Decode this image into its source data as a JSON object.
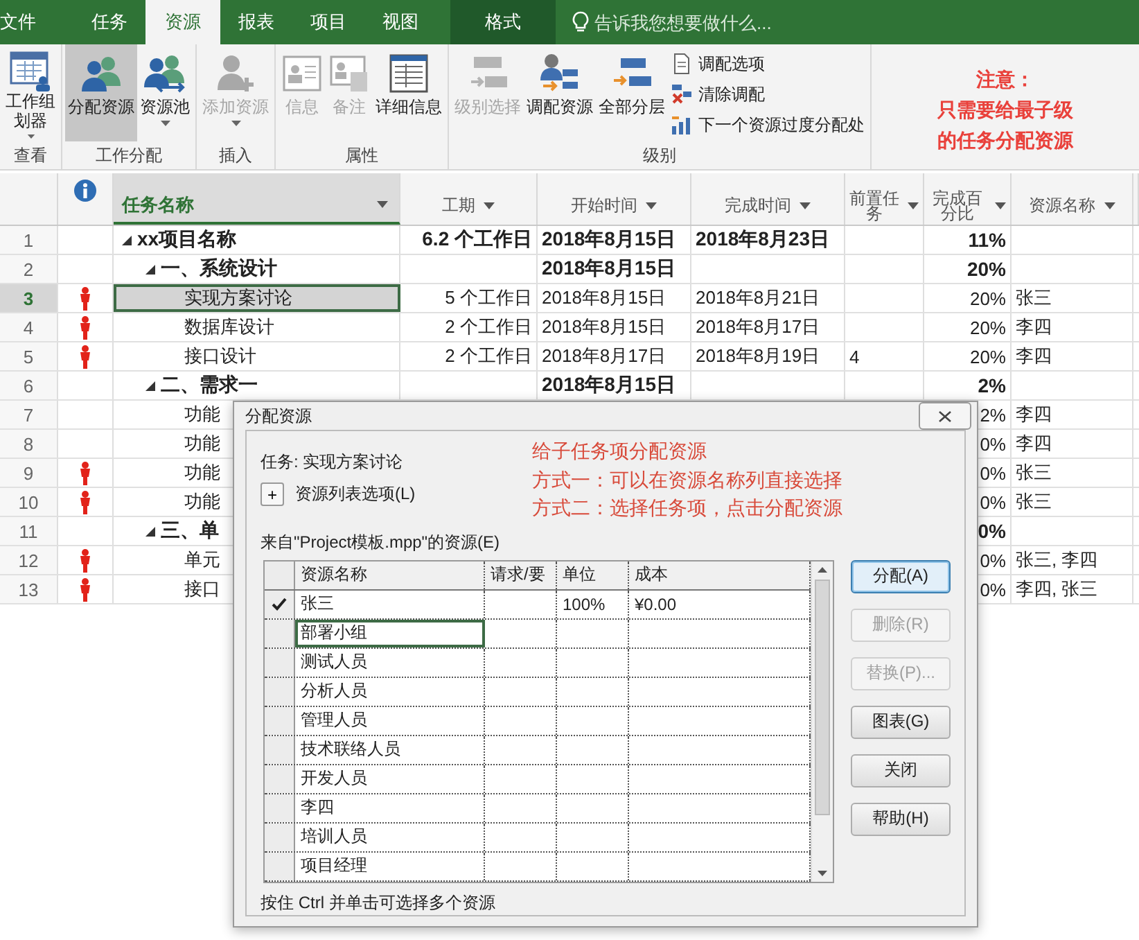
{
  "tabs": [
    {
      "label": "文件",
      "selected": false,
      "contextual": false
    },
    {
      "label": "任务",
      "selected": false,
      "contextual": false
    },
    {
      "label": "资源",
      "selected": true,
      "contextual": false
    },
    {
      "label": "报表",
      "selected": false,
      "contextual": false
    },
    {
      "label": "项目",
      "selected": false,
      "contextual": false
    },
    {
      "label": "视图",
      "selected": false,
      "contextual": false
    },
    {
      "label": "格式",
      "selected": false,
      "contextual": true
    }
  ],
  "tell_me": {
    "placeholder": "告诉我您想要做什么..."
  },
  "ribbon": {
    "groups": [
      {
        "label": "查看",
        "buttons": [
          {
            "kind": "large",
            "lines": [
              "工作组",
              "划器"
            ],
            "disabled": false,
            "selected": false,
            "dropdown": true
          }
        ]
      },
      {
        "label": "工作分配",
        "buttons": [
          {
            "kind": "large",
            "lines": [
              "分配资源"
            ],
            "disabled": false,
            "selected": true,
            "dropdown": false
          },
          {
            "kind": "large",
            "lines": [
              "资源池"
            ],
            "disabled": false,
            "selected": false,
            "dropdown": true
          }
        ]
      },
      {
        "label": "插入",
        "buttons": [
          {
            "kind": "large",
            "lines": [
              "添加资源"
            ],
            "disabled": true,
            "selected": false,
            "dropdown": true
          }
        ]
      },
      {
        "label": "属性",
        "buttons": [
          {
            "kind": "large",
            "lines": [
              "信息"
            ],
            "disabled": true,
            "selected": false,
            "dropdown": false
          },
          {
            "kind": "large",
            "lines": [
              "备注"
            ],
            "disabled": true,
            "selected": false,
            "dropdown": false
          },
          {
            "kind": "large",
            "lines": [
              "详细信息"
            ],
            "disabled": false,
            "selected": false,
            "dropdown": false
          }
        ]
      },
      {
        "label": "级别",
        "buttons": [
          {
            "kind": "large",
            "lines": [
              "级别选择"
            ],
            "disabled": true,
            "selected": false,
            "dropdown": false
          },
          {
            "kind": "large",
            "lines": [
              "调配资源"
            ],
            "disabled": false,
            "selected": false,
            "dropdown": false
          },
          {
            "kind": "large",
            "lines": [
              "全部分层"
            ],
            "disabled": false,
            "selected": false,
            "dropdown": false
          },
          {
            "kind": "small",
            "lines": [
              "调配选项"
            ],
            "disabled": false,
            "selected": false
          },
          {
            "kind": "small",
            "lines": [
              "清除调配"
            ],
            "disabled": false,
            "selected": false
          },
          {
            "kind": "small",
            "lines": [
              "下一个资源过度分配处"
            ],
            "disabled": false,
            "selected": false
          }
        ]
      }
    ]
  },
  "note": {
    "lines": [
      "注意：",
      "只需要给最子级",
      "的任务分配资源"
    ]
  },
  "grid": {
    "columns": [
      {
        "label": "任务名称",
        "selected": true
      },
      {
        "label": "工期",
        "selected": false
      },
      {
        "label": "开始时间",
        "selected": false
      },
      {
        "label": "完成时间",
        "selected": false
      },
      {
        "label": "前置任务",
        "selected": false
      },
      {
        "label": "完成百分比",
        "selected": false
      },
      {
        "label": "资源名称",
        "selected": false
      }
    ],
    "rows": [
      {
        "id": "1",
        "name": "xx项目名称",
        "duration": "6.2 个工作日",
        "start": "2018年8月15日",
        "finish": "2018年8月23日",
        "percent": "11%",
        "overallocated": false,
        "selected": false,
        "expanded": true,
        "children": [
          {
            "id": "2",
            "name": "一、系统设计",
            "start": "2018年8月15日",
            "percent": "20%",
            "overallocated": false,
            "selected": false,
            "expanded": true,
            "children": [
              {
                "id": "3",
                "name": "实现方案讨论",
                "duration": "5 个工作日",
                "start": "2018年8月15日",
                "finish": "2018年8月21日",
                "percent": "20%",
                "resources": "张三",
                "overallocated": true,
                "selected": true
              },
              {
                "id": "4",
                "name": "数据库设计",
                "duration": "2 个工作日",
                "start": "2018年8月15日",
                "finish": "2018年8月17日",
                "percent": "20%",
                "resources": "李四",
                "overallocated": true,
                "selected": false
              },
              {
                "id": "5",
                "name": "接口设计",
                "duration": "2 个工作日",
                "start": "2018年8月17日",
                "finish": "2018年8月19日",
                "predecessors": "4",
                "percent": "20%",
                "resources": "李四",
                "overallocated": true,
                "selected": false
              }
            ]
          },
          {
            "id": "6",
            "name": "二、需求一",
            "start": "2018年8月15日",
            "percent": "2%",
            "overallocated": false,
            "selected": false,
            "expanded": true,
            "children": [
              {
                "id": "7",
                "name": "功能",
                "percent": "2%",
                "resources": "李四",
                "overallocated": false,
                "selected": false
              },
              {
                "id": "8",
                "name": "功能",
                "percent": "0%",
                "resources": "李四",
                "overallocated": false,
                "selected": false
              },
              {
                "id": "9",
                "name": "功能",
                "percent": "0%",
                "resources": "张三",
                "overallocated": true,
                "selected": false
              },
              {
                "id": "10",
                "name": "功能",
                "percent": "0%",
                "resources": "张三",
                "overallocated": true,
                "selected": false
              }
            ]
          },
          {
            "id": "11",
            "name": "三、单",
            "percent": "0%",
            "overallocated": false,
            "selected": false,
            "expanded": true,
            "children": [
              {
                "id": "12",
                "name": "单元",
                "percent": "0%",
                "resources": "张三, 李四",
                "overallocated": true,
                "selected": false
              },
              {
                "id": "13",
                "name": "接口",
                "percent": "0%",
                "resources": "李四, 张三",
                "overallocated": true,
                "selected": false
              }
            ]
          }
        ]
      }
    ]
  },
  "dialog": {
    "title": "分配资源",
    "task_label": "任务: 实现方案讨论",
    "options_button": "+",
    "options_label": "资源列表选项(L)",
    "annotation": [
      "给子任务项分配资源",
      "方式一：可以在资源名称列直接选择",
      "方式二：选择任务项，点击分配资源"
    ],
    "source_label": "来自\"Project模板.mpp\"的资源(E)",
    "columns": [
      "资源名称",
      "请求/要",
      "单位",
      "成本"
    ],
    "rows": [
      {
        "name": "张三",
        "units": "100%",
        "cost": "¥0.00",
        "assigned": true,
        "selected": false
      },
      {
        "name": "部署小组",
        "assigned": false,
        "selected": true
      },
      {
        "name": "测试人员",
        "assigned": false,
        "selected": false
      },
      {
        "name": "分析人员",
        "assigned": false,
        "selected": false
      },
      {
        "name": "管理人员",
        "assigned": false,
        "selected": false
      },
      {
        "name": "技术联络人员",
        "assigned": false,
        "selected": false
      },
      {
        "name": "开发人员",
        "assigned": false,
        "selected": false
      },
      {
        "name": "李四",
        "assigned": false,
        "selected": false
      },
      {
        "name": "培训人员",
        "assigned": false,
        "selected": false
      },
      {
        "name": "项目经理",
        "assigned": false,
        "selected": false
      }
    ],
    "buttons": [
      {
        "label": "分配(A)",
        "disabled": false,
        "default": true
      },
      {
        "label": "删除(R)",
        "disabled": true,
        "default": false
      },
      {
        "label": "替换(P)...",
        "disabled": true,
        "default": false
      },
      {
        "label": "图表(G)",
        "disabled": false,
        "default": false
      },
      {
        "label": "关闭",
        "disabled": false,
        "default": false
      },
      {
        "label": "帮助(H)",
        "disabled": false,
        "default": false
      }
    ],
    "hint": "按住 Ctrl 并单击可选择多个资源"
  }
}
